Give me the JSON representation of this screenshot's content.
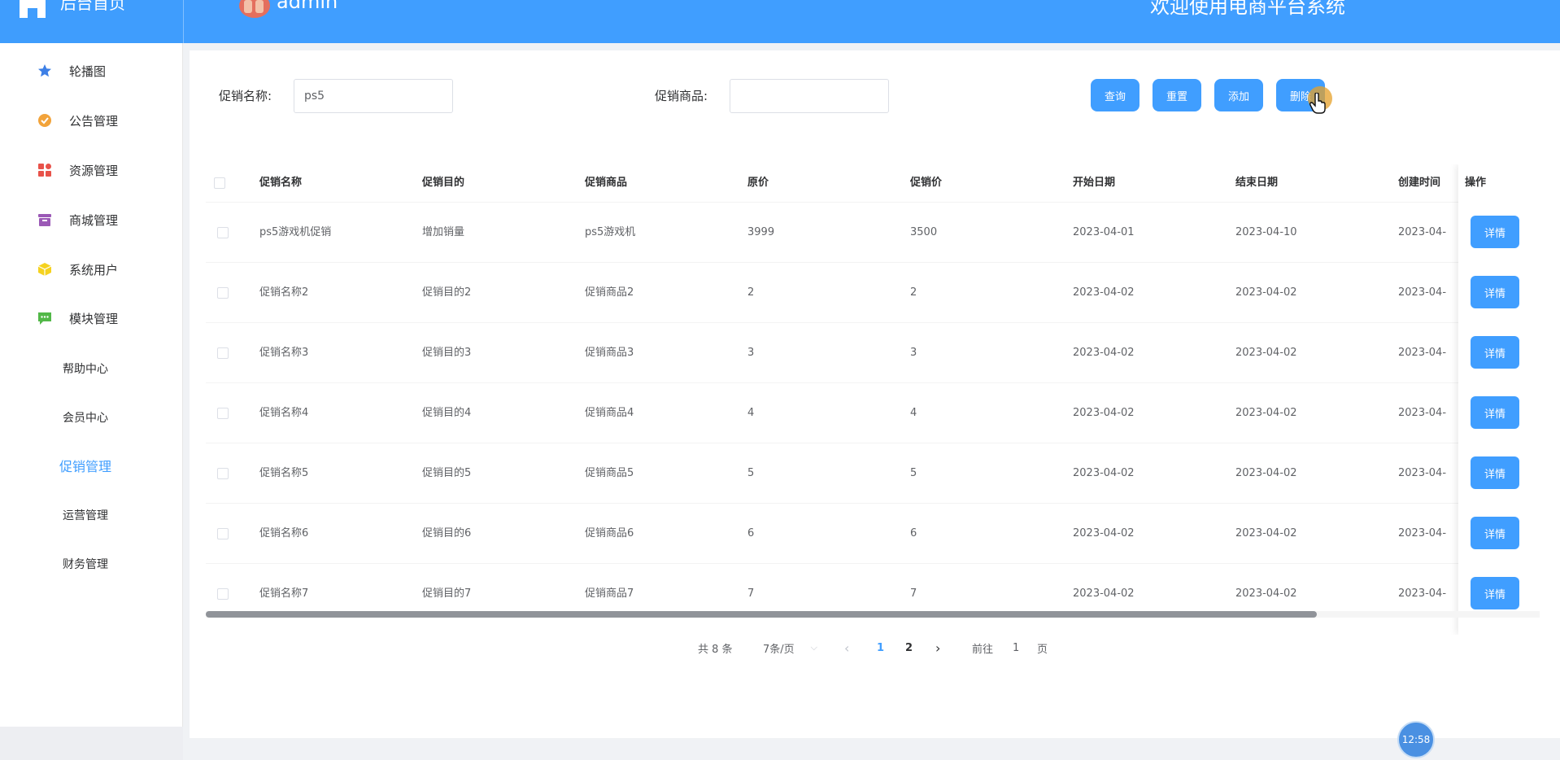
{
  "header": {
    "brand_title": "后台首页",
    "user_name": "admin",
    "welcome": "欢迎使用电商平台系统"
  },
  "sidebar": {
    "items": [
      {
        "label": "轮播图",
        "icon": "star-icon",
        "color": "#3d7fe6"
      },
      {
        "label": "公告管理",
        "icon": "badge-icon",
        "color": "#f2a33a"
      },
      {
        "label": "资源管理",
        "icon": "grid-icon",
        "color": "#e8524a"
      },
      {
        "label": "商城管理",
        "icon": "archive-icon",
        "color": "#9b59b6"
      },
      {
        "label": "系统用户",
        "icon": "cube-icon",
        "color": "#f5d21f"
      },
      {
        "label": "模块管理",
        "icon": "chat-icon",
        "color": "#52b848"
      }
    ],
    "sub_items": [
      {
        "label": "帮助中心"
      },
      {
        "label": "会员中心"
      },
      {
        "label": "促销管理",
        "active": true
      },
      {
        "label": "运营管理"
      },
      {
        "label": "财务管理"
      }
    ]
  },
  "search": {
    "name_label": "促销名称:",
    "name_value": "ps5",
    "product_label": "促销商品:",
    "product_value": "",
    "query_label": "查询",
    "reset_label": "重置",
    "add_label": "添加",
    "delete_label": "删除"
  },
  "table": {
    "columns": [
      "促销名称",
      "促销目的",
      "促销商品",
      "原价",
      "促销价",
      "开始日期",
      "结束日期",
      "创建时间",
      "操作"
    ],
    "rows": [
      {
        "name": "ps5游戏机促销",
        "purpose": "增加销量",
        "product": "ps5游戏机",
        "orig": "3999",
        "promo": "3500",
        "start": "2023-04-01",
        "end": "2023-04-10",
        "created": "2023-04-"
      },
      {
        "name": "促销名称2",
        "purpose": "促销目的2",
        "product": "促销商品2",
        "orig": "2",
        "promo": "2",
        "start": "2023-04-02",
        "end": "2023-04-02",
        "created": "2023-04-"
      },
      {
        "name": "促销名称3",
        "purpose": "促销目的3",
        "product": "促销商品3",
        "orig": "3",
        "promo": "3",
        "start": "2023-04-02",
        "end": "2023-04-02",
        "created": "2023-04-"
      },
      {
        "name": "促销名称4",
        "purpose": "促销目的4",
        "product": "促销商品4",
        "orig": "4",
        "promo": "4",
        "start": "2023-04-02",
        "end": "2023-04-02",
        "created": "2023-04-"
      },
      {
        "name": "促销名称5",
        "purpose": "促销目的5",
        "product": "促销商品5",
        "orig": "5",
        "promo": "5",
        "start": "2023-04-02",
        "end": "2023-04-02",
        "created": "2023-04-"
      },
      {
        "name": "促销名称6",
        "purpose": "促销目的6",
        "product": "促销商品6",
        "orig": "6",
        "promo": "6",
        "start": "2023-04-02",
        "end": "2023-04-02",
        "created": "2023-04-"
      },
      {
        "name": "促销名称7",
        "purpose": "促销目的7",
        "product": "促销商品7",
        "orig": "7",
        "promo": "7",
        "start": "2023-04-02",
        "end": "2023-04-02",
        "created": "2023-04-"
      }
    ],
    "detail_label": "详情"
  },
  "pagination": {
    "total": "共 8 条",
    "page_size": "7条/页",
    "pages": [
      "1",
      "2"
    ],
    "current_page": "1",
    "goto_prefix": "前往",
    "goto_value": "1",
    "goto_suffix": "页"
  },
  "clock": "12:58",
  "colors": {
    "primary": "#409eff",
    "header": "#409eff"
  }
}
